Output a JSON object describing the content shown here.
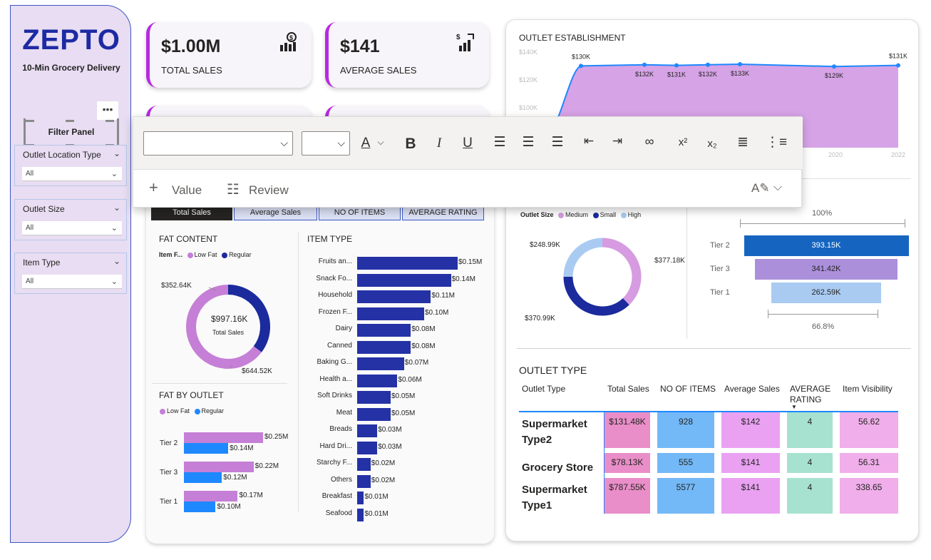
{
  "sidebar": {
    "brand": "ZEPTO",
    "tagline": "10-Min Grocery Delivery",
    "more": "•••",
    "filter_panel": "Filter Panel",
    "slicers": [
      {
        "label": "Outlet Location Type",
        "value": "All"
      },
      {
        "label": "Outlet Size",
        "value": "All"
      },
      {
        "label": "Item Type",
        "value": "All"
      }
    ]
  },
  "kpis": [
    {
      "value": "$1.00M",
      "label": "TOTAL SALES"
    },
    {
      "value": "$141",
      "label": "AVERAGE SALES"
    }
  ],
  "toolbar": {
    "value_btn": "Value",
    "review_btn": "Review",
    "superscript": "x²",
    "subscript": "x₂"
  },
  "tabs": [
    "Total Sales",
    "Average Sales",
    "NO OF ITEMS",
    "AVERAGE RATING"
  ],
  "colors": {
    "accent": "#b82be0",
    "brand": "#1d2aa3",
    "lowfat": "#c57fd6",
    "regular": "#1b2a9c",
    "bar": "#2432a6",
    "blue": "#1e88ff"
  },
  "fat_content": {
    "title": "FAT CONTENT",
    "legend_title": "Item F...",
    "legend": [
      "Low Fat",
      "Regular"
    ],
    "center_value": "$997.16K",
    "center_label": "Total Sales",
    "label_regular": "$352.64K",
    "label_lowfat": "$644.52K"
  },
  "fat_by_outlet": {
    "title": "FAT BY OUTLET",
    "legend": [
      "Low Fat",
      "Regular"
    ]
  },
  "item_type": {
    "title": "ITEM TYPE"
  },
  "outlet_establishment": {
    "title": "OUTLET ESTABLISHMENT"
  },
  "outlet_size": {
    "legend_title": "Outlet Size",
    "legend": [
      "Medium",
      "Small",
      "High"
    ],
    "label_high": "$248.99K",
    "label_medium": "$377.18K",
    "label_small": "$370.99K"
  },
  "funnel": {
    "top_pct": "100%",
    "bottom_pct": "66.8%"
  },
  "outlet_type": {
    "title": "OUTLET TYPE",
    "columns": [
      "Outlet Type",
      "Total Sales",
      "NO OF ITEMS",
      "Average Sales",
      "AVERAGE RATING",
      "Item Visibility"
    ],
    "rows": [
      {
        "type": "Supermarket Type2",
        "sales": "$131.48K",
        "items": "928",
        "avg": "$142",
        "rating": "4",
        "vis": "56.62"
      },
      {
        "type": "Grocery Store",
        "sales": "$78.13K",
        "items": "555",
        "avg": "$141",
        "rating": "4",
        "vis": "56.31"
      },
      {
        "type": "Supermarket Type1",
        "sales": "$787.55K",
        "items": "5577",
        "avg": "$141",
        "rating": "4",
        "vis": "338.65"
      }
    ]
  },
  "chart_data": [
    {
      "type": "bar",
      "title": "ITEM TYPE",
      "orientation": "horizontal",
      "categories": [
        "Fruits an...",
        "Snack Fo...",
        "Household",
        "Frozen F...",
        "Dairy",
        "Canned",
        "Baking G...",
        "Health a...",
        "Soft Drinks",
        "Meat",
        "Breads",
        "Hard Dri...",
        "Starchy F...",
        "Others",
        "Breakfast",
        "Seafood"
      ],
      "values": [
        0.15,
        0.14,
        0.11,
        0.1,
        0.08,
        0.08,
        0.07,
        0.06,
        0.05,
        0.05,
        0.03,
        0.03,
        0.02,
        0.02,
        0.01,
        0.01
      ],
      "value_labels": [
        "$0.15M",
        "$0.14M",
        "$0.11M",
        "$0.10M",
        "$0.08M",
        "$0.08M",
        "$0.07M",
        "$0.06M",
        "$0.05M",
        "$0.05M",
        "$0.03M",
        "$0.03M",
        "$0.02M",
        "$0.02M",
        "$0.01M",
        "$0.01M"
      ]
    },
    {
      "type": "bar",
      "title": "FAT BY OUTLET",
      "orientation": "horizontal",
      "categories": [
        "Tier 2",
        "Tier 3",
        "Tier 1"
      ],
      "series": [
        {
          "name": "Low Fat",
          "values": [
            0.25,
            0.22,
            0.17
          ],
          "labels": [
            "$0.25M",
            "$0.22M",
            "$0.17M"
          ]
        },
        {
          "name": "Regular",
          "values": [
            0.14,
            0.12,
            0.1
          ],
          "labels": [
            "$0.14M",
            "$0.12M",
            "$0.10M"
          ]
        }
      ]
    },
    {
      "type": "area",
      "title": "OUTLET ESTABLISHMENT",
      "x_ticks": [
        "2020",
        "2022"
      ],
      "y_ticks": [
        "$140K",
        "$120K",
        "$100K"
      ],
      "points": [
        {
          "label": "$130K",
          "value": 130
        },
        {
          "label": "$132K",
          "value": 132
        },
        {
          "label": "$131K",
          "value": 131
        },
        {
          "label": "$132K",
          "value": 132
        },
        {
          "label": "$133K",
          "value": 133
        },
        {
          "label": "$129K",
          "value": 129
        },
        {
          "label": "$131K",
          "value": 131
        }
      ]
    },
    {
      "type": "pie",
      "title": "FAT CONTENT",
      "categories": [
        "Low Fat",
        "Regular"
      ],
      "values": [
        644.52,
        352.64
      ]
    },
    {
      "type": "pie",
      "title": "Outlet Size",
      "categories": [
        "Medium",
        "Small",
        "High"
      ],
      "values": [
        377.18,
        370.99,
        248.99
      ]
    },
    {
      "type": "bar",
      "title": "Funnel",
      "categories": [
        "Tier 2",
        "Tier 3",
        "Tier 1"
      ],
      "values": [
        393.15,
        341.42,
        262.59
      ],
      "value_labels": [
        "393.15K",
        "341.42K",
        "262.59K"
      ]
    }
  ]
}
